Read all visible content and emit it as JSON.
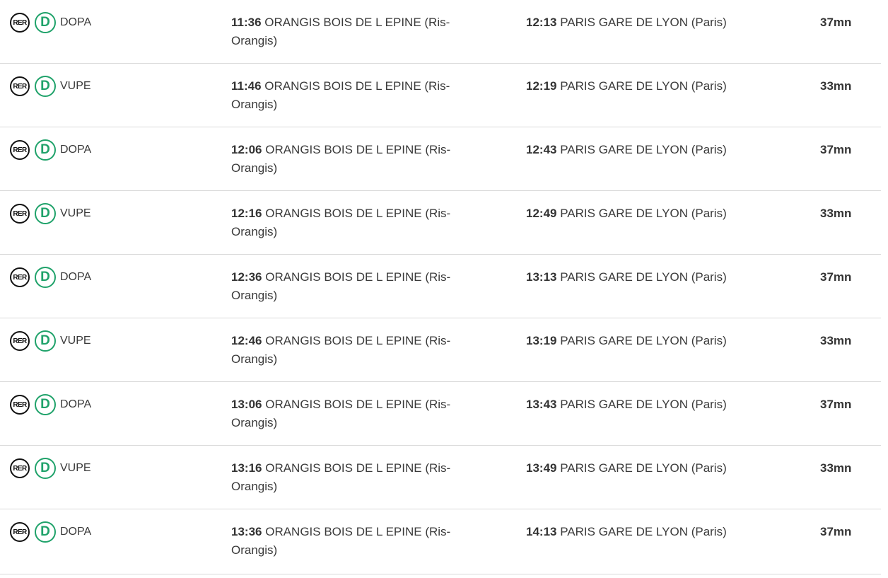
{
  "rows": [
    {
      "mode": "RER",
      "line": "D",
      "mission": "DOPA",
      "dep_time": "11:36",
      "dep_station": "ORANGIS BOIS DE L EPINE (Ris-",
      "dep_station_cont": "Orangis)",
      "arr_time": "12:13",
      "arr_station": "PARIS GARE DE LYON (Paris)",
      "duration": "37mn"
    },
    {
      "mode": "RER",
      "line": "D",
      "mission": "VUPE",
      "dep_time": "11:46",
      "dep_station": "ORANGIS BOIS DE L EPINE (Ris-",
      "dep_station_cont": "Orangis)",
      "arr_time": "12:19",
      "arr_station": "PARIS GARE DE LYON (Paris)",
      "duration": "33mn"
    },
    {
      "mode": "RER",
      "line": "D",
      "mission": "DOPA",
      "dep_time": "12:06",
      "dep_station": "ORANGIS BOIS DE L EPINE (Ris-",
      "dep_station_cont": "Orangis)",
      "arr_time": "12:43",
      "arr_station": "PARIS GARE DE LYON (Paris)",
      "duration": "37mn"
    },
    {
      "mode": "RER",
      "line": "D",
      "mission": "VUPE",
      "dep_time": "12:16",
      "dep_station": "ORANGIS BOIS DE L EPINE (Ris-",
      "dep_station_cont": "Orangis)",
      "arr_time": "12:49",
      "arr_station": "PARIS GARE DE LYON (Paris)",
      "duration": "33mn"
    },
    {
      "mode": "RER",
      "line": "D",
      "mission": "DOPA",
      "dep_time": "12:36",
      "dep_station": "ORANGIS BOIS DE L EPINE (Ris-",
      "dep_station_cont": "Orangis)",
      "arr_time": "13:13",
      "arr_station": "PARIS GARE DE LYON (Paris)",
      "duration": "37mn"
    },
    {
      "mode": "RER",
      "line": "D",
      "mission": "VUPE",
      "dep_time": "12:46",
      "dep_station": "ORANGIS BOIS DE L EPINE (Ris-",
      "dep_station_cont": "Orangis)",
      "arr_time": "13:19",
      "arr_station": "PARIS GARE DE LYON (Paris)",
      "duration": "33mn"
    },
    {
      "mode": "RER",
      "line": "D",
      "mission": "DOPA",
      "dep_time": "13:06",
      "dep_station": "ORANGIS BOIS DE L EPINE (Ris-",
      "dep_station_cont": "Orangis)",
      "arr_time": "13:43",
      "arr_station": "PARIS GARE DE LYON (Paris)",
      "duration": "37mn"
    },
    {
      "mode": "RER",
      "line": "D",
      "mission": "VUPE",
      "dep_time": "13:16",
      "dep_station": "ORANGIS BOIS DE L EPINE (Ris-",
      "dep_station_cont": "Orangis)",
      "arr_time": "13:49",
      "arr_station": "PARIS GARE DE LYON (Paris)",
      "duration": "33mn"
    },
    {
      "mode": "RER",
      "line": "D",
      "mission": "DOPA",
      "dep_time": "13:36",
      "dep_station": "ORANGIS BOIS DE L EPINE (Ris-",
      "dep_station_cont": "Orangis)",
      "arr_time": "14:13",
      "arr_station": "PARIS GARE DE LYON (Paris)",
      "duration": "37mn"
    }
  ],
  "colors": {
    "rer_icon": "#111111",
    "line_d": "#1fa26a",
    "text": "#3a3a3a",
    "divider": "#d9d9d9"
  },
  "icons": {
    "mode": "rer-icon",
    "line": "line-d-icon"
  }
}
